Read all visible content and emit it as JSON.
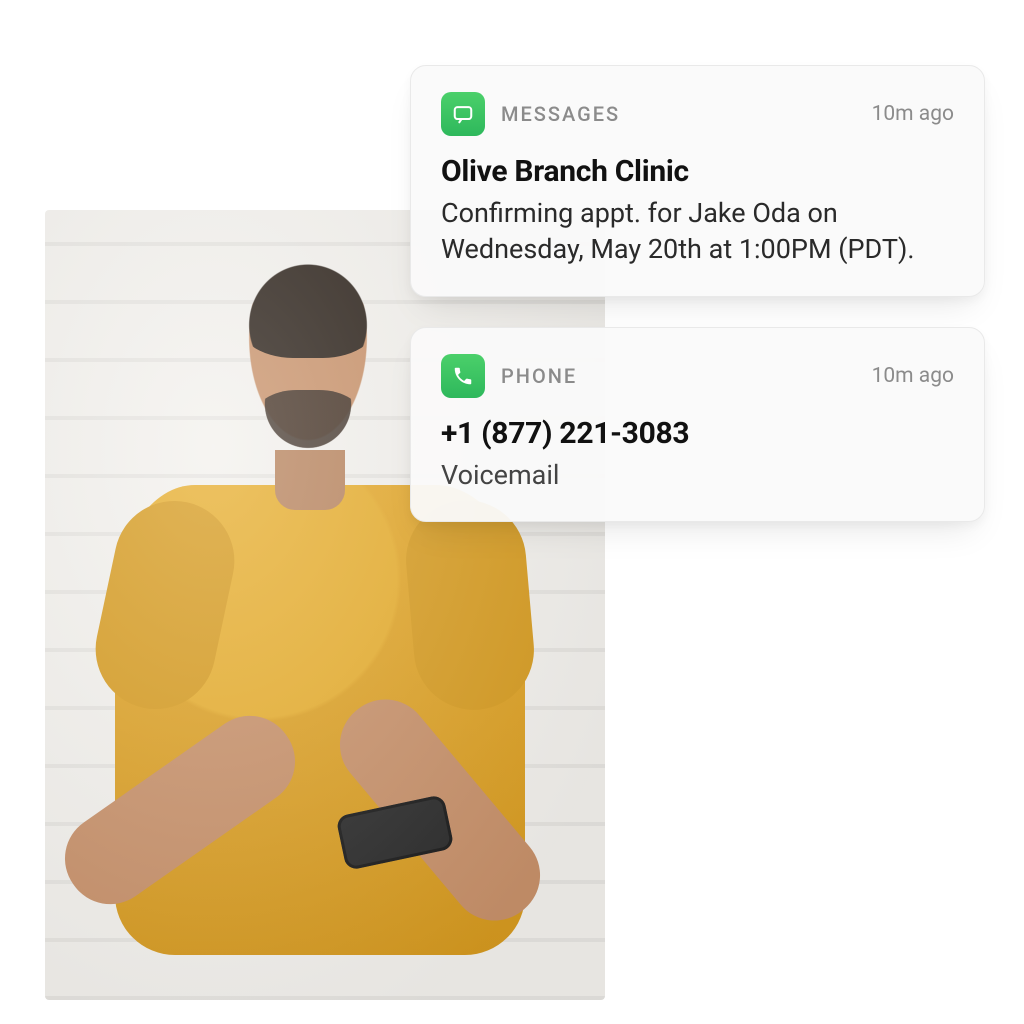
{
  "photo": {
    "alt": "Man in mustard t-shirt looking at phone against white brick wall"
  },
  "colors": {
    "icon_bg": "#35c463",
    "muted": "#8b8b8b",
    "text": "#111111"
  },
  "notifications": [
    {
      "app": "MESSAGES",
      "icon": "message-icon",
      "timestamp": "10m ago",
      "title": "Olive Branch Clinic",
      "body": "Confirming appt. for Jake Oda on Wednesday, May 20th at 1:00PM (PDT)."
    },
    {
      "app": "PHONE",
      "icon": "phone-icon",
      "timestamp": "10m ago",
      "title": "+1 (877) 221-3083",
      "body": "Voicemail"
    }
  ]
}
